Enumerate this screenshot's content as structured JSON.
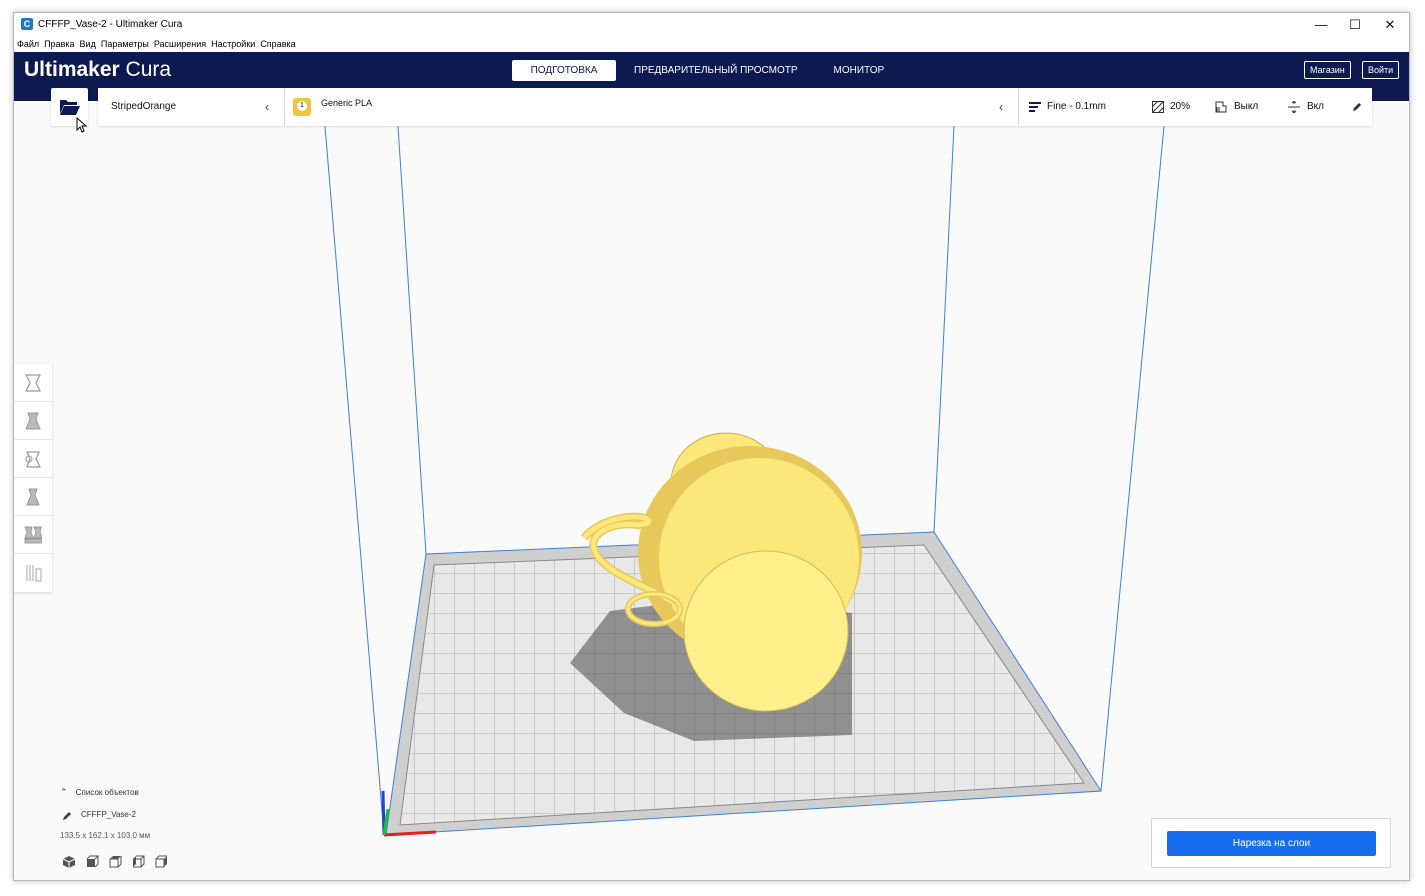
{
  "window": {
    "title": "CFFFP_Vase-2 - Ultimaker Cura"
  },
  "menu": [
    "Файл",
    "Правка",
    "Вид",
    "Параметры",
    "Расширения",
    "Настройки",
    "Справка"
  ],
  "header": {
    "logo_bold": "Ultimaker",
    "logo_light": " Cura",
    "tabs": [
      {
        "label": "ПОДГОТОВКА",
        "active": true
      },
      {
        "label": "ПРЕДВАРИТЕЛЬНЫЙ ПРОСМОТР",
        "active": false
      },
      {
        "label": "МОНИТОР",
        "active": false
      }
    ],
    "marketplace_label": "Магазин",
    "signin_label": "Войти"
  },
  "settings_bar": {
    "printer": "StripedOrange",
    "extruder_number": "1",
    "material": "Generic PLA",
    "profile": "Fine - 0.1mm",
    "infill": "20%",
    "support": "Выкл",
    "adhesion": "Вкл"
  },
  "left_tools": [
    "move-tool-icon",
    "scale-tool-icon",
    "rotate-tool-icon",
    "mirror-tool-icon",
    "per-model-settings-icon",
    "support-blocker-icon"
  ],
  "object_list": {
    "toggle_label": "Список объектов",
    "object_name": "CFFFP_Vase-2",
    "dimensions": "133.5 x 162.1 x 103.0 мм"
  },
  "slice": {
    "button_label": "Нарезка на слои"
  },
  "colors": {
    "header": "#0c1a51",
    "accent": "#196ef0",
    "model": "#fbe77a"
  }
}
